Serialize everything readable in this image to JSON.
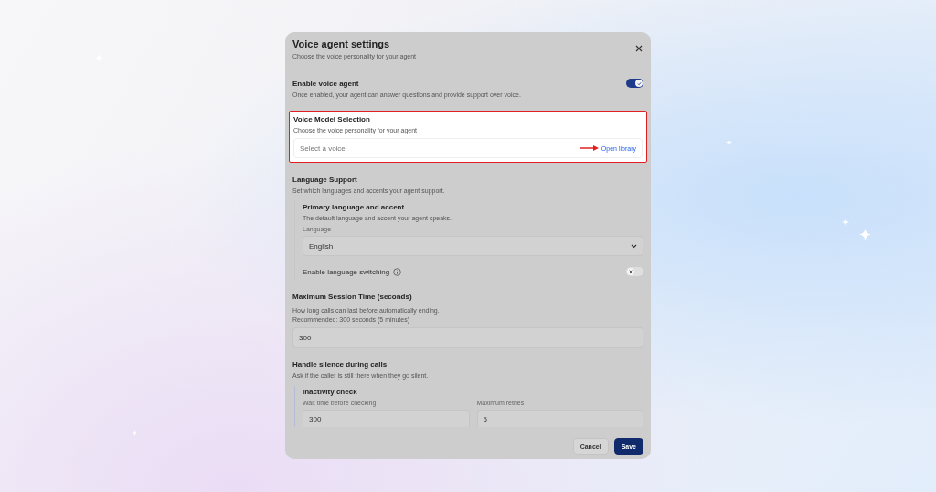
{
  "dialog": {
    "title": "Voice agent settings",
    "subtitle": "Choose the voice personality for your agent"
  },
  "enable_voice_agent": {
    "label": "Enable voice agent",
    "description": "Once enabled, your agent can answer questions and provide support over voice.",
    "on": true
  },
  "voice_model": {
    "title": "Voice Model Selection",
    "subtitle": "Choose the voice personality for your agent",
    "placeholder": "Select a voice",
    "link": "Open library",
    "highlighted": true
  },
  "language_support": {
    "title": "Language Support",
    "subtitle": "Set which languages and accents your agent support.",
    "primary": {
      "title": "Primary language and accent",
      "description": "The default language and accent your agent speaks.",
      "field_label": "Language",
      "value": "English"
    },
    "switching": {
      "label": "Enable language switching",
      "on": false
    }
  },
  "session_time": {
    "title": "Maximum Session Time (seconds)",
    "help": [
      "How long calls can last before automatically ending.",
      "Recommended: 300 seconds (5 minutes)"
    ],
    "value": "300"
  },
  "silence": {
    "title": "Handle silence during calls",
    "subtitle": "Ask if the caller is still there when they go silent.",
    "inactivity": {
      "title": "Inactivity check",
      "fields": [
        {
          "label": "Wait time before checking",
          "value": "300"
        },
        {
          "label": "Maximum retries",
          "value": "5"
        }
      ]
    }
  },
  "buttons": [
    {
      "label": "Cancel",
      "kind": "secondary"
    },
    {
      "label": "Save",
      "kind": "primary"
    }
  ]
}
